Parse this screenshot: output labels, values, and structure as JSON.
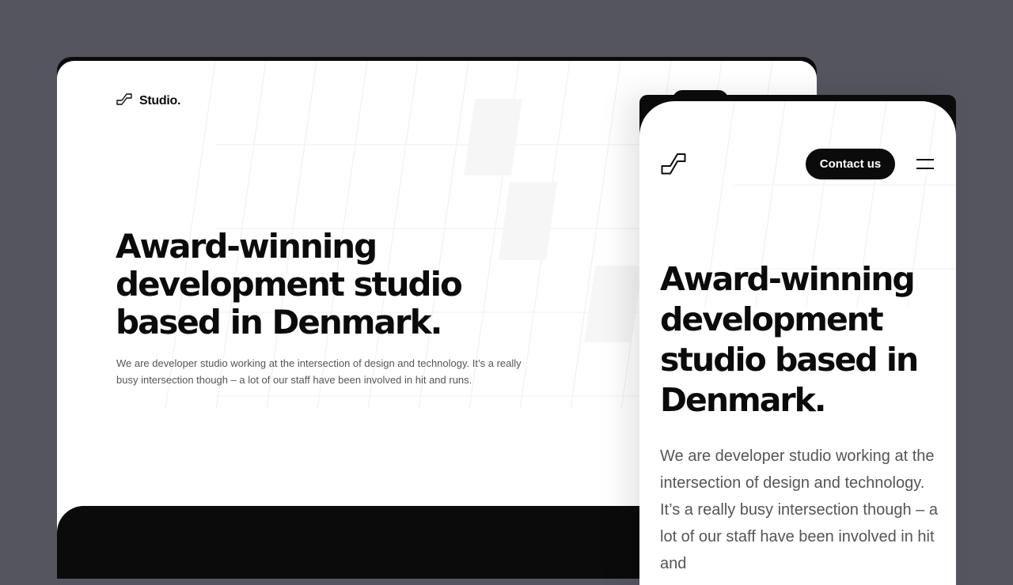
{
  "colors": {
    "backdrop": "#55555f",
    "ink": "#0b0b0c",
    "screen": "#ffffff",
    "body_text": "#555555"
  },
  "desktop": {
    "brand": {
      "logo_icon": "stair-step-logo-icon",
      "name": "Studio."
    },
    "hero": {
      "headline_lines": [
        "Award-winning",
        "development studio",
        "based in Denmark."
      ],
      "description": "We are developer studio working at the intersection of design and technology. It’s a really busy intersection though – a lot of our staff have been involved in hit and runs."
    }
  },
  "mobile": {
    "brand": {
      "logo_icon": "stair-step-logo-icon"
    },
    "header": {
      "contact_label": "Contact us",
      "menu_icon": "hamburger-menu-icon"
    },
    "hero": {
      "headline_lines": [
        "Award-winning",
        "development",
        "studio based in",
        "Denmark."
      ],
      "description": "We are developer studio working at the intersection of design and technology. It’s a really busy intersection though – a lot of our staff have been involved in hit and"
    }
  }
}
